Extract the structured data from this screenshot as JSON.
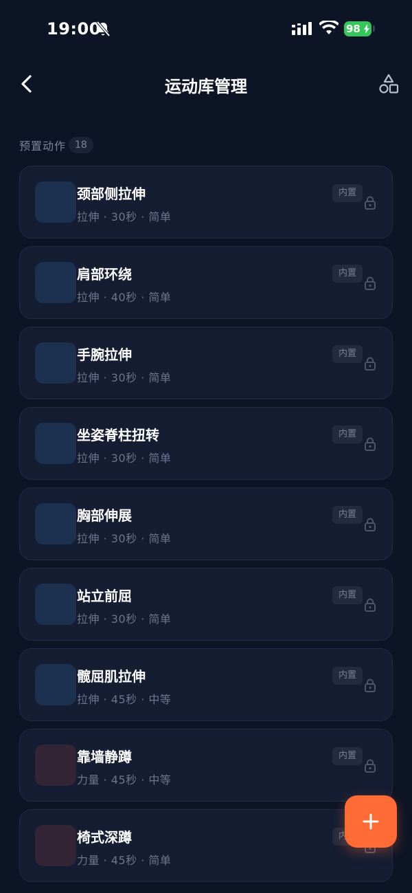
{
  "status_bar": {
    "time": "19:00",
    "battery": "98"
  },
  "nav": {
    "title": "运动库管理"
  },
  "section": {
    "title": "预置动作",
    "count": "18"
  },
  "items": [
    {
      "title": "颈部侧拉伸",
      "meta": "拉伸 · 30秒 · 简单",
      "badge": "内置",
      "kind": "stretch"
    },
    {
      "title": "肩部环绕",
      "meta": "拉伸 · 40秒 · 简单",
      "badge": "内置",
      "kind": "stretch"
    },
    {
      "title": "手腕拉伸",
      "meta": "拉伸 · 30秒 · 简单",
      "badge": "内置",
      "kind": "stretch"
    },
    {
      "title": "坐姿脊柱扭转",
      "meta": "拉伸 · 30秒 · 简单",
      "badge": "内置",
      "kind": "stretch"
    },
    {
      "title": "胸部伸展",
      "meta": "拉伸 · 30秒 · 简单",
      "badge": "内置",
      "kind": "stretch"
    },
    {
      "title": "站立前屈",
      "meta": "拉伸 · 30秒 · 简单",
      "badge": "内置",
      "kind": "stretch"
    },
    {
      "title": "髋屈肌拉伸",
      "meta": "拉伸 · 45秒 · 中等",
      "badge": "内置",
      "kind": "stretch"
    },
    {
      "title": "靠墙静蹲",
      "meta": "力量 · 45秒 · 中等",
      "badge": "内置",
      "kind": "strength"
    },
    {
      "title": "椅式深蹲",
      "meta": "力量 · 45秒 · 简单",
      "badge": "内置",
      "kind": "strength"
    }
  ],
  "icons": {
    "back": "chevron-left-icon",
    "shapes": "shapes-icon",
    "lock": "lock-icon",
    "add": "plus-icon",
    "bell": "bell-off-icon"
  },
  "colors": {
    "accent": "#ff6b35",
    "background": "#0d1426",
    "battery": "#34c759"
  }
}
